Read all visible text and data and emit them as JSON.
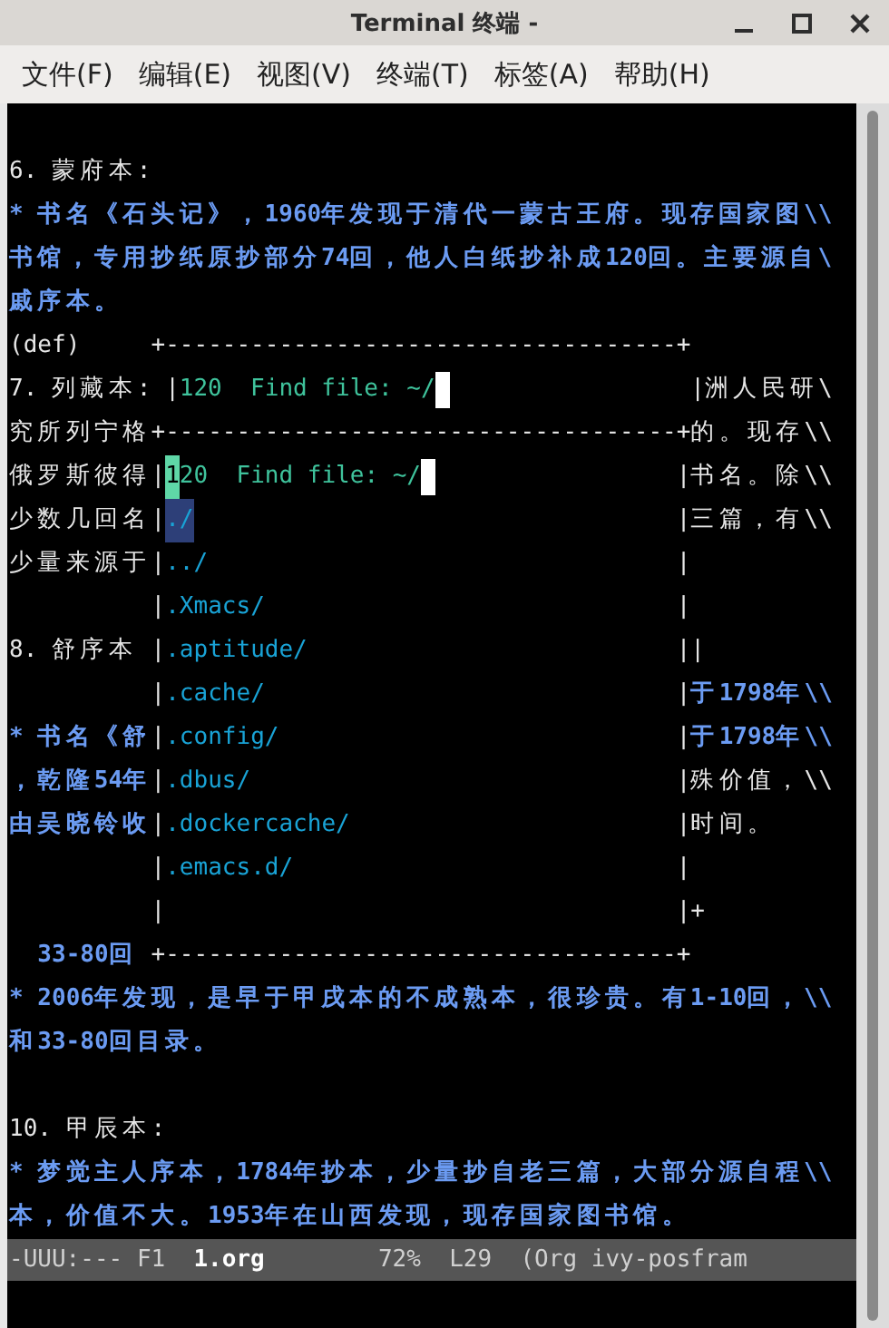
{
  "window": {
    "title": "Terminal 终端 -"
  },
  "menu": [
    "文件(F)",
    "编辑(E)",
    "视图(V)",
    "终端(T)",
    "标签(A)",
    "帮助(H)"
  ],
  "lines": [
    {
      "kind": "plain",
      "space_before": true,
      "segments": [
        {
          "kind": "text",
          "text": "6. 蒙府本:"
        }
      ]
    },
    {
      "kind": "plain",
      "segments": [
        {
          "kind": "note",
          "text": "* 书名《石头记》，1960年发现于清代一蒙古王府。现存国家图\\\\"
        }
      ]
    },
    {
      "kind": "plain",
      "segments": [
        {
          "kind": "note",
          "text": "书馆，专用抄纸原抄部分74回，他人白纸抄补成120回。主要源自\\"
        }
      ]
    },
    {
      "kind": "plain",
      "segments": [
        {
          "kind": "note",
          "text": "戚序本。"
        }
      ]
    },
    {
      "kind": "frame",
      "left": [
        {
          "kind": "text",
          "text": "(def)"
        }
      ],
      "frame": "+------------------------------------+"
    },
    {
      "kind": "popup",
      "left": [
        {
          "kind": "text",
          "text": "7. 列藏本: "
        }
      ],
      "bar_left": "|",
      "content": [
        {
          "kind": "prompt",
          "text": "120  Find file: ~/"
        }
      ],
      "cursor": true,
      "bar_right": "|",
      "right": [
        {
          "kind": "text",
          "text": "洲人民研\\"
        }
      ]
    },
    {
      "kind": "frame",
      "left": [
        {
          "kind": "text",
          "text": "究所列宁格"
        }
      ],
      "frame": "+------------------------------------+",
      "right": [
        {
          "kind": "text",
          "text": "的。现存\\\\"
        }
      ]
    },
    {
      "kind": "popup",
      "left": [
        {
          "kind": "text",
          "text": "俄罗斯彼得"
        }
      ],
      "bar_left": "|",
      "content": [
        {
          "kind": "match",
          "text": "1"
        },
        {
          "kind": "prompt",
          "text": "20  Find file: ~/"
        }
      ],
      "cursor": true,
      "bar_right": "|",
      "right": [
        {
          "kind": "text",
          "text": "书名。除\\\\"
        }
      ]
    },
    {
      "kind": "popup",
      "left": [
        {
          "kind": "text",
          "text": "少数几回名"
        }
      ],
      "bar_left": "|",
      "content": [
        {
          "kind": "dir",
          "text": "./",
          "selected": true
        }
      ],
      "bar_right": "|",
      "right": [
        {
          "kind": "text",
          "text": "三篇，有\\\\"
        }
      ]
    },
    {
      "kind": "popup",
      "left": [
        {
          "kind": "text",
          "text": "少量来源于"
        }
      ],
      "bar_left": "|",
      "content": [
        {
          "kind": "dir",
          "text": "../",
          "selected": false
        }
      ],
      "bar_right": "|"
    },
    {
      "kind": "popup",
      "bar_left": "|",
      "content": [
        {
          "kind": "dir",
          "text": ".Xmacs/",
          "selected": false
        }
      ],
      "bar_right": "|"
    },
    {
      "kind": "popup",
      "left": [
        {
          "kind": "text",
          "text": "8. 舒序本"
        }
      ],
      "bar_left": "|",
      "content": [
        {
          "kind": "dir",
          "text": ".aptitude/",
          "selected": false
        }
      ],
      "bar_right": "|",
      "right": [
        {
          "kind": "border",
          "text": "|"
        }
      ]
    },
    {
      "kind": "popup",
      "bar_left": "|",
      "content": [
        {
          "kind": "dir",
          "text": ".cache/",
          "selected": false
        }
      ],
      "bar_right": "|",
      "right": [
        {
          "kind": "note",
          "text": "于1798年\\\\"
        }
      ]
    },
    {
      "kind": "popup",
      "left": [
        {
          "kind": "note",
          "text": "* 书名《舒"
        }
      ],
      "bar_left": "|",
      "content": [
        {
          "kind": "dir",
          "text": ".config/",
          "selected": false
        }
      ],
      "bar_right": "|",
      "right": [
        {
          "kind": "note",
          "text": "于1798年\\\\"
        }
      ]
    },
    {
      "kind": "popup",
      "left": [
        {
          "kind": "note",
          "text": "，乾隆54年"
        }
      ],
      "bar_left": "|",
      "content": [
        {
          "kind": "dir",
          "text": ".dbus/",
          "selected": false
        }
      ],
      "bar_right": "|",
      "right": [
        {
          "kind": "text",
          "text": "殊价值，\\\\"
        }
      ]
    },
    {
      "kind": "popup",
      "left": [
        {
          "kind": "note",
          "text": "由吴晓铃收"
        }
      ],
      "bar_left": "|",
      "content": [
        {
          "kind": "dir",
          "text": ".dockercache/",
          "selected": false
        }
      ],
      "bar_right": "|",
      "right": [
        {
          "kind": "text",
          "text": "时间。"
        }
      ]
    },
    {
      "kind": "popup",
      "bar_left": "|",
      "content": [
        {
          "kind": "dir",
          "text": ".emacs.d/",
          "selected": false
        }
      ],
      "bar_right": "|"
    },
    {
      "kind": "popup",
      "bar_left": "|",
      "bar_right": "|",
      "right": [
        {
          "kind": "border",
          "text": "+"
        }
      ]
    },
    {
      "kind": "frame",
      "left": [
        {
          "kind": "note",
          "text": "  33-80回"
        }
      ],
      "frame": "+------------------------------------+"
    },
    {
      "kind": "plain",
      "segments": [
        {
          "kind": "note",
          "text": "* 2006年发现，是早于甲戌本的不成熟本，很珍贵。有1-10回，\\\\"
        }
      ]
    },
    {
      "kind": "plain",
      "segments": [
        {
          "kind": "note",
          "text": "和33-80回目录。"
        }
      ]
    },
    {
      "kind": "plain",
      "space_before": true,
      "segments": [
        {
          "kind": "text",
          "text": "10. 甲辰本:"
        }
      ]
    },
    {
      "kind": "plain",
      "segments": [
        {
          "kind": "note",
          "text": "* 梦觉主人序本，1784年抄本，少量抄自老三篇，大部分源自程\\\\"
        }
      ]
    },
    {
      "kind": "plain",
      "segments": [
        {
          "kind": "note",
          "text": "本，价值不大。1953年在山西发现，现存国家图书馆。"
        }
      ]
    }
  ],
  "mode_line": [
    {
      "kind": "status",
      "text": "-UUU:--- F1"
    },
    {
      "kind": "buffer",
      "text": "1.org"
    },
    {
      "kind": "status",
      "text": "72%"
    },
    {
      "kind": "status",
      "text": "L29"
    },
    {
      "kind": "status",
      "text": "(Org ivy-posfram"
    }
  ]
}
